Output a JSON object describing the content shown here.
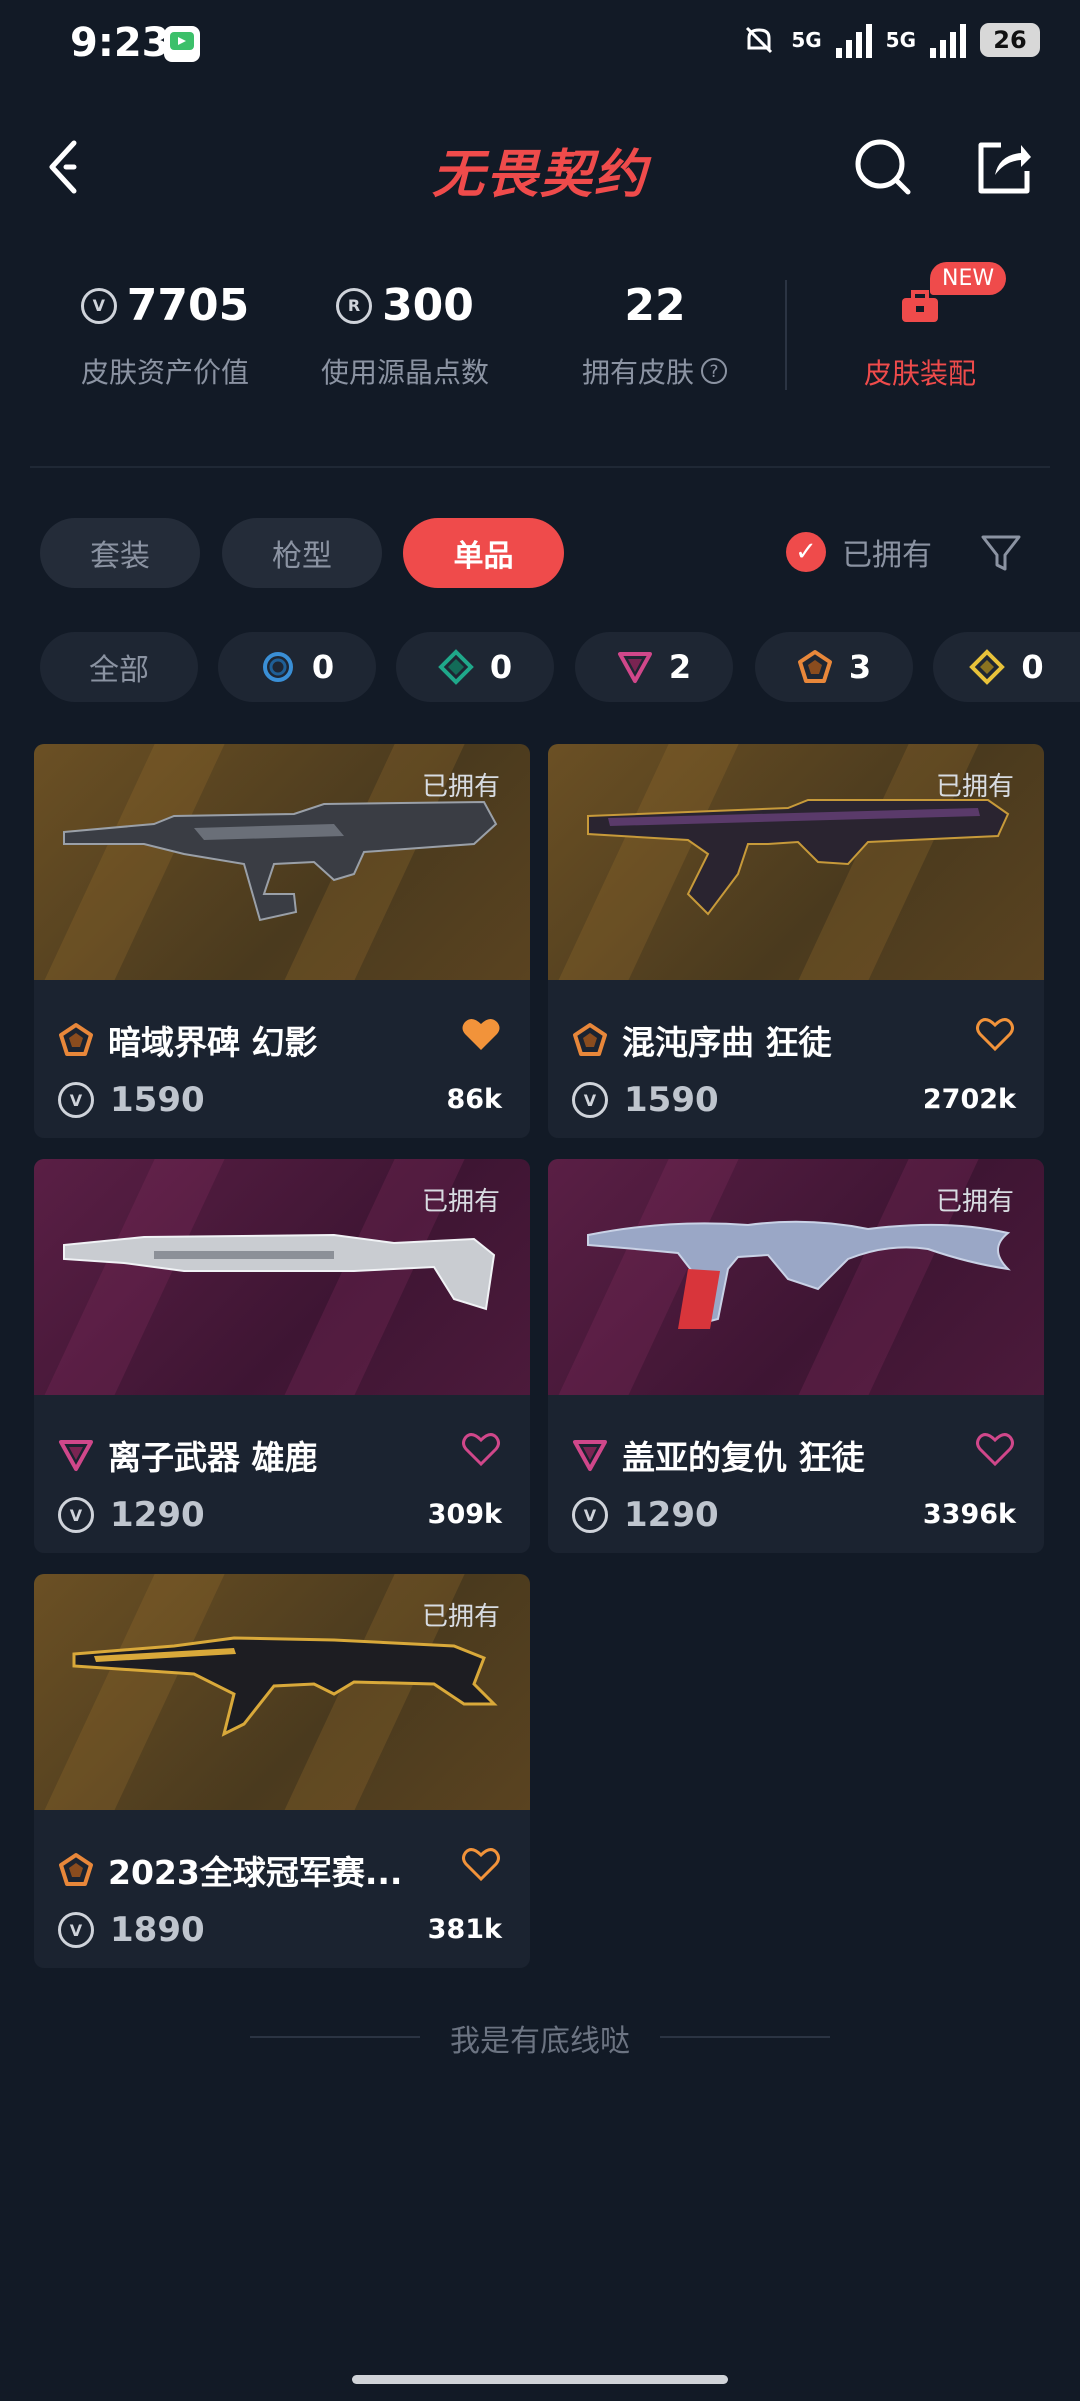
{
  "status_bar": {
    "time": "9:23",
    "signal1": "5G",
    "signal2": "5G",
    "battery": "26"
  },
  "header": {
    "title": "无畏契约",
    "back_icon": "chevron-left-icon",
    "search_icon": "search-icon",
    "share_icon": "share-icon"
  },
  "stats": [
    {
      "value": "7705",
      "label": "皮肤资产价值"
    },
    {
      "value": "300",
      "label": "使用源晶点数"
    },
    {
      "value": "22",
      "label": "拥有皮肤"
    }
  ],
  "equip": {
    "label": "皮肤装配",
    "badge": "NEW"
  },
  "tabs": [
    {
      "label": "套装"
    },
    {
      "label": "枪型"
    },
    {
      "label": "单品"
    }
  ],
  "owned_filter": {
    "label": "已拥有"
  },
  "rarity_chips": [
    {
      "label": "全部"
    },
    {
      "count": "0",
      "color": "#3a8fd6"
    },
    {
      "count": "0",
      "color": "#1fa88a"
    },
    {
      "count": "2",
      "color": "#d0478a"
    },
    {
      "count": "3",
      "color": "#e8873a"
    },
    {
      "count": "0",
      "color": "#e8c23a"
    }
  ],
  "cards": [
    {
      "owned": "已拥有",
      "name": "暗域界碑 幻影",
      "price": "1590",
      "likes": "86k",
      "liked": true,
      "tier_color": "#e8873a"
    },
    {
      "owned": "已拥有",
      "name": "混沌序曲 狂徒",
      "price": "1590",
      "likes": "2702k",
      "liked": false,
      "tier_color": "#e8873a"
    },
    {
      "owned": "已拥有",
      "name": "离子武器 雄鹿",
      "price": "1290",
      "likes": "309k",
      "liked": false,
      "tier_color": "#d0478a"
    },
    {
      "owned": "已拥有",
      "name": "盖亚的复仇 狂徒",
      "price": "1290",
      "likes": "3396k",
      "liked": false,
      "tier_color": "#d0478a"
    },
    {
      "owned": "已拥有",
      "name": "2023全球冠军赛...",
      "price": "1890",
      "likes": "381k",
      "liked": false,
      "tier_color": "#e8873a"
    }
  ],
  "footer": {
    "text": "我是有底线哒"
  }
}
